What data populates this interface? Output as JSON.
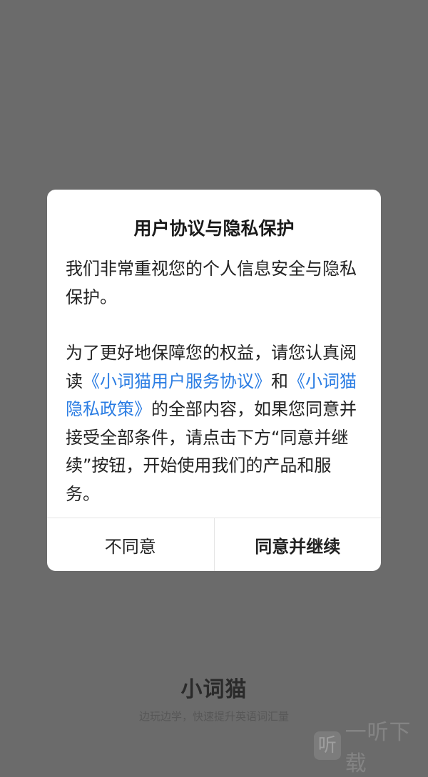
{
  "splash": {
    "app_name": "小词猫",
    "tagline": "边玩边学，快速提升英语词汇量"
  },
  "watermark": {
    "logo_char": "听",
    "text": "一听下载"
  },
  "dialog": {
    "title": "用户协议与隐私保护",
    "intro": "我们非常重视您的个人信息安全与隐私保护。",
    "body_part1": "为了更好地保障您的权益，请您认真阅读",
    "link_terms": "《小词猫用户服务协议》",
    "body_and": "和",
    "link_privacy": "《小词猫隐私政策》",
    "body_part2": "的全部内容，如果您同意并接受全部条件，请点击下方“同意并继续”按钮，开始使用我们的产品和服务。",
    "decline_label": "不同意",
    "accept_label": "同意并继续"
  },
  "colors": {
    "backdrop": "#6b6b6b",
    "link": "#2b7de3",
    "dialog_bg": "#ffffff"
  }
}
